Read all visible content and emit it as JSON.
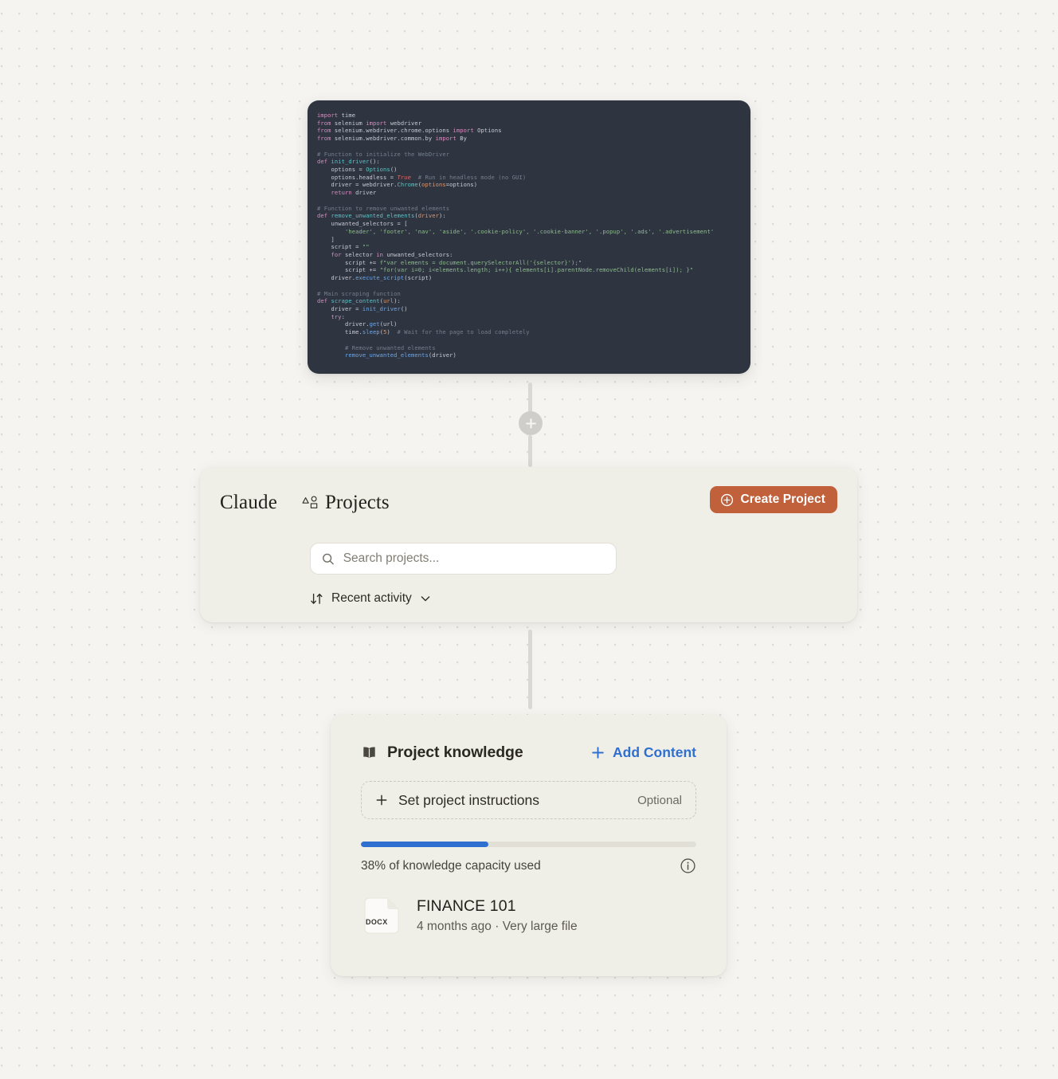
{
  "code_block": {
    "language": "python",
    "lines": [
      [
        [
          "kw",
          "import "
        ],
        [
          "op",
          "time"
        ]
      ],
      [
        [
          "kw",
          "from "
        ],
        [
          "op",
          "selenium "
        ],
        [
          "kw",
          "import "
        ],
        [
          "op",
          "webdriver"
        ]
      ],
      [
        [
          "kw",
          "from "
        ],
        [
          "op",
          "selenium.webdriver.chrome.options "
        ],
        [
          "kw",
          "import "
        ],
        [
          "op",
          "Options"
        ]
      ],
      [
        [
          "kw",
          "from "
        ],
        [
          "op",
          "selenium.webdriver.common.by "
        ],
        [
          "kw",
          "import "
        ],
        [
          "op",
          "By"
        ]
      ],
      [],
      [
        [
          "cmt",
          "# Function to initialize the WebDriver"
        ]
      ],
      [
        [
          "kw",
          "def "
        ],
        [
          "fn",
          "init_driver"
        ],
        [
          "op",
          "():"
        ]
      ],
      [
        [
          "op",
          "    options "
        ],
        [
          "op",
          "= "
        ],
        [
          "cls",
          "Options"
        ],
        [
          "op",
          "()"
        ]
      ],
      [
        [
          "op",
          "    options.headless = "
        ],
        [
          "bool",
          "True"
        ],
        [
          "cmt",
          "  # Run in headless mode (no GUI)"
        ]
      ],
      [
        [
          "op",
          "    driver = webdriver."
        ],
        [
          "cls",
          "Chrome"
        ],
        [
          "op",
          "("
        ],
        [
          "par",
          "options"
        ],
        [
          "op",
          "=options)"
        ]
      ],
      [
        [
          "kw",
          "    return "
        ],
        [
          "op",
          "driver"
        ]
      ],
      [],
      [
        [
          "cmt",
          "# Function to remove unwanted elements"
        ]
      ],
      [
        [
          "kw",
          "def "
        ],
        [
          "fn",
          "remove_unwanted_elements"
        ],
        [
          "op",
          "("
        ],
        [
          "par",
          "driver"
        ],
        [
          "op",
          "):"
        ]
      ],
      [
        [
          "op",
          "    unwanted_selectors = ["
        ]
      ],
      [
        [
          "str",
          "        'header', 'footer', 'nav', 'aside', '.cookie-policy', '.cookie-banner', '.popup', '.ads', '.advertisement'"
        ]
      ],
      [
        [
          "op",
          "    ]"
        ]
      ],
      [
        [
          "op",
          "    script = "
        ],
        [
          "str",
          "\"\""
        ]
      ],
      [
        [
          "kw",
          "    for "
        ],
        [
          "op",
          "selector "
        ],
        [
          "kw",
          "in "
        ],
        [
          "op",
          "unwanted_selectors:"
        ]
      ],
      [
        [
          "op",
          "        script "
        ],
        [
          "op",
          "+= "
        ],
        [
          "str",
          "f\"var elements = document.querySelectorAll('{selector}');\""
        ]
      ],
      [
        [
          "op",
          "        script += "
        ],
        [
          "str",
          "\"for(var i=0; i<elements.length; i++){ elements[i].parentNode.removeChild(elements[i]); }\""
        ]
      ],
      [
        [
          "op",
          "    driver."
        ],
        [
          "call",
          "execute_script"
        ],
        [
          "op",
          "(script)"
        ]
      ],
      [],
      [
        [
          "cmt",
          "# Main scraping function"
        ]
      ],
      [
        [
          "kw",
          "def "
        ],
        [
          "fn",
          "scrape_content"
        ],
        [
          "op",
          "("
        ],
        [
          "par",
          "url"
        ],
        [
          "op",
          "):"
        ]
      ],
      [
        [
          "op",
          "    driver = "
        ],
        [
          "call",
          "init_driver"
        ],
        [
          "op",
          "()"
        ]
      ],
      [
        [
          "kw",
          "    try"
        ],
        [
          "op",
          ":"
        ]
      ],
      [
        [
          "op",
          "        driver."
        ],
        [
          "call",
          "get"
        ],
        [
          "op",
          "(url)"
        ]
      ],
      [
        [
          "op",
          "        time."
        ],
        [
          "call",
          "sleep"
        ],
        [
          "op",
          "("
        ],
        [
          "num",
          "5"
        ],
        [
          "op",
          ")"
        ],
        [
          "cmt",
          "  # Wait for the page to load completely"
        ]
      ],
      [],
      [
        [
          "cmt",
          "        # Remove unwanted elements"
        ]
      ],
      [
        [
          "call",
          "        remove_unwanted_elements"
        ],
        [
          "op",
          "(driver)"
        ]
      ]
    ]
  },
  "projects_card": {
    "brand": "Claude",
    "section_label": "Projects",
    "section_icon": "shapes-icon",
    "create_button": {
      "label": "Create Project",
      "icon": "plus-circle-icon",
      "color": "#c1613c"
    },
    "search": {
      "placeholder": "Search projects...",
      "value": "",
      "icon": "search-icon"
    },
    "sort": {
      "label": "Recent activity",
      "icon": "sort-arrows-icon",
      "chevron": "chevron-down-icon"
    }
  },
  "knowledge_card": {
    "title": "Project knowledge",
    "title_icon": "book-icon",
    "add_content": {
      "label": "Add Content",
      "icon": "plus-icon",
      "color": "#2f6fd0"
    },
    "instructions": {
      "label": "Set project instructions",
      "badge": "Optional",
      "icon": "plus-icon"
    },
    "capacity": {
      "percent": 38,
      "percent_label": "38% of knowledge capacity used",
      "bar_color": "#2f6fd0",
      "info_icon": "info-circle-icon"
    },
    "files": [
      {
        "type": "DOCX",
        "name": "FINANCE 101",
        "meta": "4 months ago · Very large file",
        "icon": "document-icon"
      }
    ]
  },
  "connectors": {
    "add_node_icon": "plus-icon"
  }
}
